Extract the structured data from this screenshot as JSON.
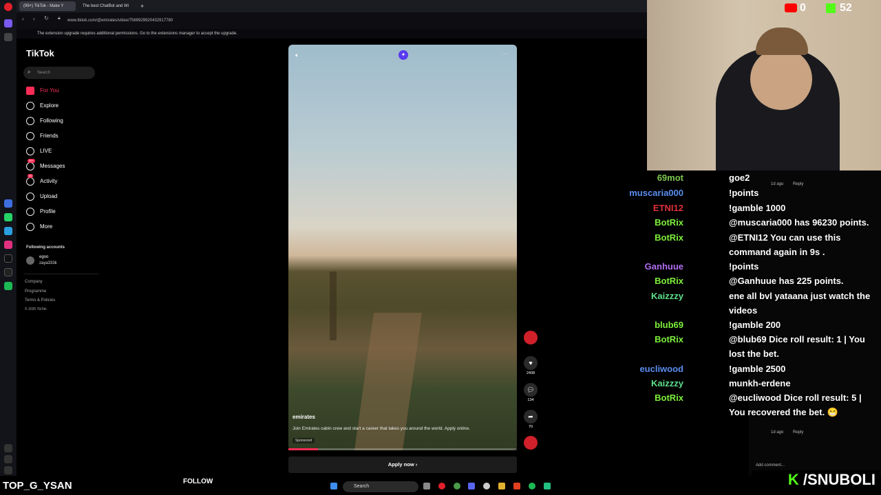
{
  "browser": {
    "tabs": [
      {
        "label": "(99+) TikTok - Make Y"
      },
      {
        "label": "The best ChatBot and Wi"
      }
    ],
    "url": "www.tiktok.com/@emirates/video/7569929920432917780",
    "notice": "The extension upgrade requires additional permissions. Go to the extensions manager to accept the upgrade."
  },
  "tiktok": {
    "logo": "TikTok",
    "search_placeholder": "Search",
    "nav": [
      {
        "label": "For You",
        "icon": "home-icon"
      },
      {
        "label": "Explore",
        "icon": "compass-icon"
      },
      {
        "label": "Following",
        "icon": "user-follow-icon"
      },
      {
        "label": "Friends",
        "icon": "friends-icon"
      },
      {
        "label": "LIVE",
        "icon": "live-icon"
      },
      {
        "label": "Messages",
        "icon": "message-icon",
        "badge": "99+"
      },
      {
        "label": "Activity",
        "icon": "bell-icon",
        "badge": "50"
      },
      {
        "label": "Upload",
        "icon": "upload-icon"
      },
      {
        "label": "Profile",
        "icon": "profile-icon"
      },
      {
        "label": "More",
        "icon": "more-icon"
      }
    ],
    "following_header": "Following accounts",
    "following": {
      "name": "egoo",
      "handle": "zaya333k"
    },
    "footer": [
      "Company",
      "Programme",
      "Terms & Policies",
      "© 2025 TikTok"
    ],
    "video": {
      "account": "emirates",
      "description": "Join Emirates cabin crew and start a career that takes you around the world. Apply online.",
      "sponsored": "Sponsored",
      "likes": "2408",
      "comments": "134",
      "shares": "70",
      "apply_label": "Apply now",
      "progress": 0.13
    }
  },
  "stream": {
    "youtube_viewers": "0",
    "kick_viewers": "52",
    "streamer_name": "TOP_G_YSAN",
    "follow_label": "FOLLOW",
    "kick_handle": "/SNUBOLI",
    "chat": [
      {
        "user": "69mot",
        "color": "#7ec850",
        "msg": "goe2"
      },
      {
        "user": "muscaria000",
        "color": "#5a8ef0",
        "msg": "!points"
      },
      {
        "user": "ETNI12",
        "color": "#e0303a",
        "msg": "!gamble 1000"
      },
      {
        "user": "BotRix",
        "color": "#7ef03c",
        "msg": "@muscaria000 has 96230 points."
      },
      {
        "user": "BotRix",
        "color": "#7ef03c",
        "msg": "@ETNI12 You can use this command again in 9s ."
      },
      {
        "user": "Ganhuue",
        "color": "#b06ef0",
        "msg": "!points"
      },
      {
        "user": "BotRix",
        "color": "#7ef03c",
        "msg": "@Ganhuue has 225 points."
      },
      {
        "user": "Kaizzzy",
        "color": "#5ee08a",
        "msg": "ene all bvl yataana just watch the videos"
      },
      {
        "user": "blub69",
        "color": "#7ef03c",
        "msg": "!gamble 200"
      },
      {
        "user": "BotRix",
        "color": "#7ef03c",
        "msg": "@blub69 Dice roll result: 1 | You lost the bet."
      },
      {
        "user": "eucliwood",
        "color": "#5a8ef0",
        "msg": "!gamble 2500"
      },
      {
        "user": "Kaizzzy",
        "color": "#5ee08a",
        "msg": "munkh-erdene"
      },
      {
        "user": "BotRix",
        "color": "#7ef03c",
        "msg": "@eucliwood Dice roll result: 5 | You recovered the bet. 😁"
      }
    ],
    "comments_overlay": {
      "add_comment": "Add comment...",
      "reply": "Reply",
      "time": "1d ago"
    }
  },
  "taskbar": {
    "search_label": "Search"
  }
}
